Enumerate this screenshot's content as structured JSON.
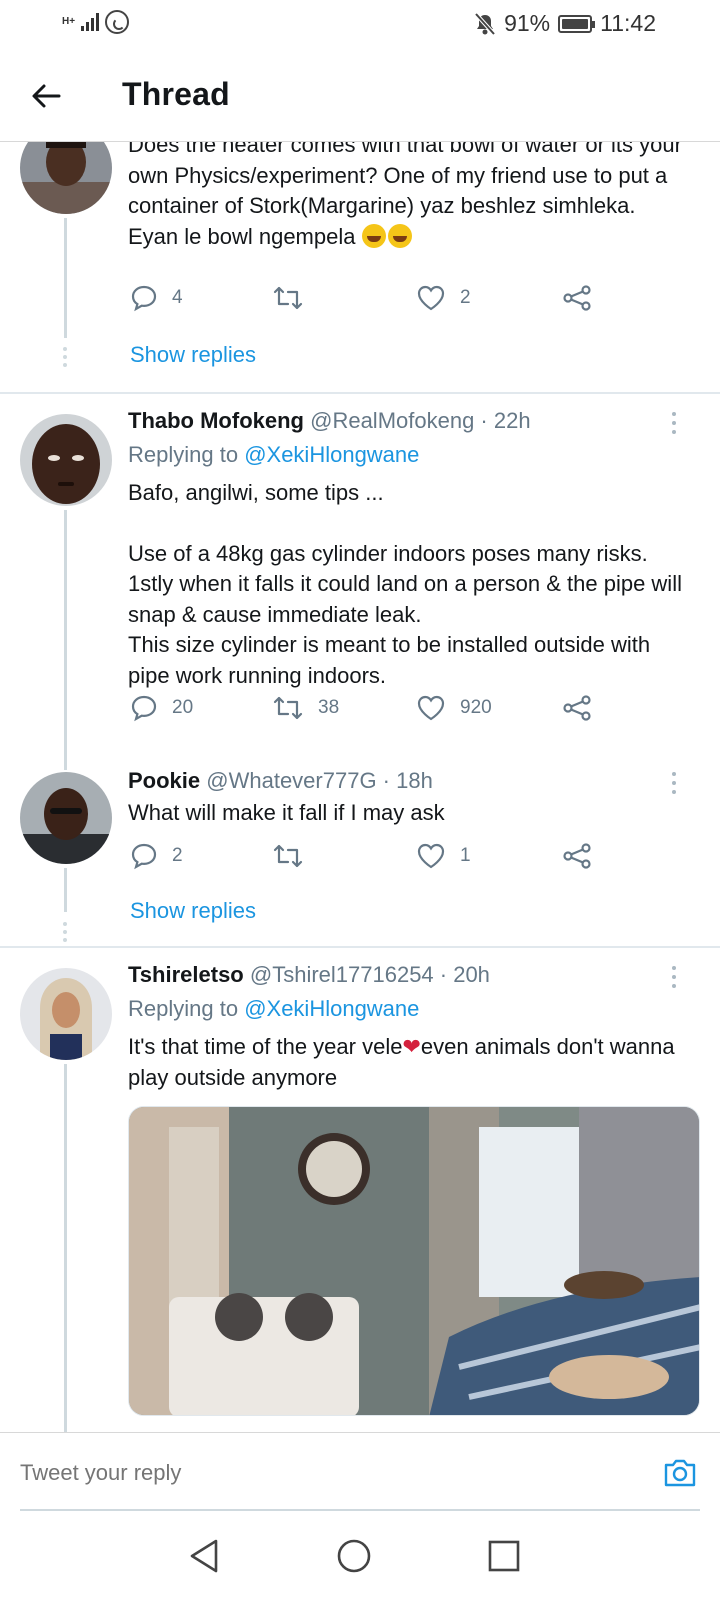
{
  "status_bar": {
    "network": "H+",
    "battery": "91%",
    "time": "11:42"
  },
  "header": {
    "title": "Thread"
  },
  "tweets": [
    {
      "name": "",
      "handle": "",
      "time": "",
      "text": "Does the heater comes with that bowl of water or its your own Physics/experiment? One of my friend use to put a container of Stork(Margarine) yaz beshlez simhleka. Eyan le bowl ngempela",
      "replies": "4",
      "retweets": "",
      "likes": "2",
      "show_replies": "Show replies"
    },
    {
      "name": "Thabo Mofokeng",
      "handle": "@RealMofokeng · 22h",
      "replying_prefix": "Replying to ",
      "replying_to": "@XekiHlongwane",
      "text_line1": "Bafo, angilwi, some tips ...",
      "text_line2": "Use of a 48kg gas cylinder indoors poses many risks. 1stly when it falls it could land on a person & the pipe will snap & cause immediate leak.",
      "text_line3": "This size cylinder is meant to be installed outside with pipe work running indoors.",
      "replies": "20",
      "retweets": "38",
      "likes": "920"
    },
    {
      "name": "Pookie",
      "handle": "@Whatever777G · 18h",
      "text": "What will make it fall if I may ask",
      "replies": "2",
      "retweets": "",
      "likes": "1",
      "show_replies": "Show replies"
    },
    {
      "name": "Tshireletso",
      "handle": "@Tshirel17716254 · 20h",
      "replying_prefix": "Replying to ",
      "replying_to": "@XekiHlongwane",
      "text_before": "It's that time of the year vele",
      "text_after": "even animals don't wanna play outside anymore"
    }
  ],
  "reply_bar": {
    "placeholder": "Tweet your reply"
  },
  "colors": {
    "accent": "#1b95e0",
    "text": "#14171a",
    "secondary": "#657786"
  }
}
